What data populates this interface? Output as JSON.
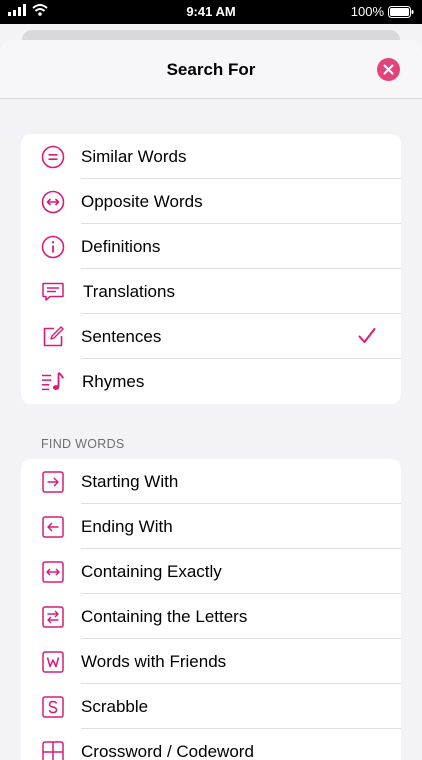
{
  "status_bar": {
    "time": "9:41 AM",
    "battery": "100%"
  },
  "sheet": {
    "title": "Search For"
  },
  "search_types": [
    {
      "label": "Similar Words",
      "icon": "equals-circle-icon",
      "selected": false
    },
    {
      "label": "Opposite Words",
      "icon": "left-right-arrow-circle-icon",
      "selected": false
    },
    {
      "label": "Definitions",
      "icon": "info-circle-icon",
      "selected": false
    },
    {
      "label": "Translations",
      "icon": "speech-bubble-icon",
      "selected": false
    },
    {
      "label": "Sentences",
      "icon": "compose-icon",
      "selected": true
    },
    {
      "label": "Rhymes",
      "icon": "music-note-icon",
      "selected": false
    }
  ],
  "find_words": {
    "header": "FIND WORDS",
    "items": [
      {
        "label": "Starting With",
        "icon": "arrow-right-square-icon"
      },
      {
        "label": "Ending With",
        "icon": "arrow-left-square-icon"
      },
      {
        "label": "Containing Exactly",
        "icon": "left-right-arrow-square-icon"
      },
      {
        "label": "Containing the Letters",
        "icon": "swap-arrows-square-icon"
      },
      {
        "label": "Words with Friends",
        "icon": "w-square-icon"
      },
      {
        "label": "Scrabble",
        "icon": "s-square-icon"
      },
      {
        "label": "Crossword / Codeword",
        "icon": "grid-square-icon"
      }
    ]
  },
  "colors": {
    "accent": "#d81b7a",
    "close_button": "#e3447c"
  }
}
